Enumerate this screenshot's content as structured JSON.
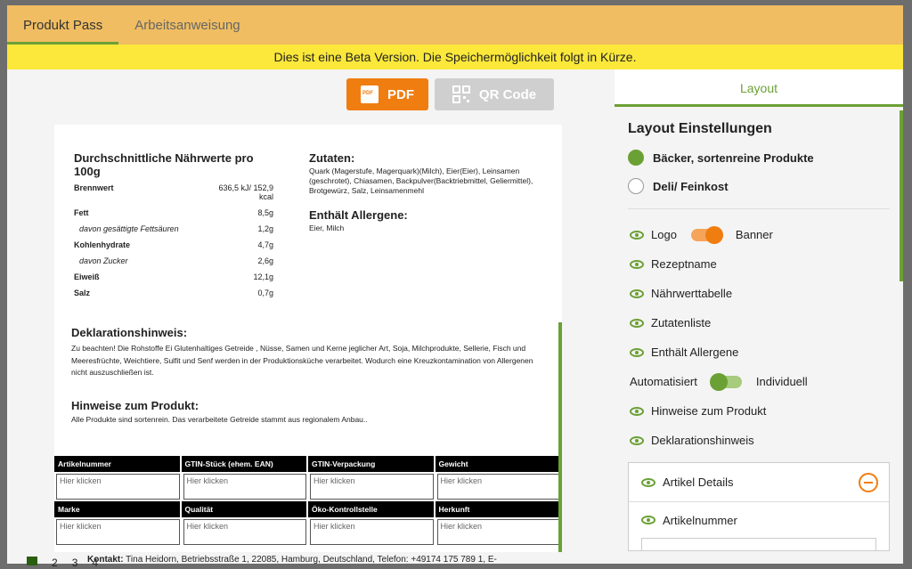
{
  "tabs": [
    {
      "label": "Produkt Pass",
      "active": true
    },
    {
      "label": "Arbeitsanweisung",
      "active": false
    }
  ],
  "beta_banner": "Dies ist eine Beta Version. Die Speichermöglichkeit folgt in Kürze.",
  "toolbar": {
    "pdf_label": "PDF",
    "qr_label": "QR Code"
  },
  "nutrition": {
    "title": "Durchschnittliche Nährwerte pro 100g",
    "rows": [
      {
        "label": "Brennwert",
        "value": "636,5 kJ/ 152,9 kcal",
        "sub": false
      },
      {
        "label": "Fett",
        "value": "8,5g",
        "sub": false
      },
      {
        "label": "davon gesättigte Fettsäuren",
        "value": "1,2g",
        "sub": true
      },
      {
        "label": "Kohlenhydrate",
        "value": "4,7g",
        "sub": false
      },
      {
        "label": "davon Zucker",
        "value": "2,6g",
        "sub": true
      },
      {
        "label": "Eiweiß",
        "value": "12,1g",
        "sub": false
      },
      {
        "label": "Salz",
        "value": "0,7g",
        "sub": false
      }
    ]
  },
  "ingredients": {
    "title": "Zutaten:",
    "text": "Quark (Magerstufe, Magerquark)(Milch), Eier(Eier), Leinsamen (geschrotet), Chiasamen, Backpulver(Backtriebmittel, Geliermittel), Brotgewürz, Salz, Leinsamenmehl",
    "allergens_title": "Enthält Allergene:",
    "allergens_text": "Eier, Milch"
  },
  "declaration": {
    "title": "Deklarationshinweis:",
    "text": "Zu beachten! Die Rohstoffe Ei Glutenhaltiges Getreide , Nüsse, Samen und Kerne jeglicher Art, Soja, Milchprodukte, Sellerie, Fisch und Meeresfrüchte, Weichtiere, Sulfit und Senf werden in der Produktionsküche verarbeitet. Wodurch eine Kreuzkontamination von Allergenen nicht auszuschließen ist."
  },
  "product_hints": {
    "title": "Hinweise zum Produkt:",
    "text": "Alle Produkte sind sortenrein. Das verarbeitete Getreide stammt aus regionalem Anbau.."
  },
  "details_table": {
    "row1_headers": [
      "Artikelnummer",
      "GTIN-Stück (ehem. EAN)",
      "GTIN-Verpackung",
      "Gewicht"
    ],
    "row2_headers": [
      "Marke",
      "Qualität",
      "Öko-Kontrollstelle",
      "Herkunft"
    ],
    "placeholder": "Hier klicken"
  },
  "contact": {
    "label": "Kontakt:",
    "text": "Tina Heidorn, Betriebsstraße 1, 22085, Hamburg, Deutschland, Telefon: +49174 175 789 1, E-"
  },
  "pager": [
    "2",
    "3",
    "4"
  ],
  "sidebar": {
    "tab_label": "Layout",
    "settings_title": "Layout Einstellungen",
    "radio_options": [
      {
        "label": "Bäcker, sortenreine Produkte",
        "selected": true
      },
      {
        "label": "Deli/ Feinkost",
        "selected": false
      }
    ],
    "logo_label": "Logo",
    "banner_label": "Banner",
    "items_top": [
      "Rezeptname",
      "Nährwerttabelle",
      "Zutatenliste",
      "Enthält Allergene"
    ],
    "auto_label": "Automatisiert",
    "individual_label": "Individuell",
    "items_bottom": [
      "Hinweise zum Produkt",
      "Deklarationshinweis"
    ],
    "accordion_title": "Artikel Details",
    "accordion_item": "Artikelnummer"
  },
  "colors": {
    "accent_green": "#6ba034",
    "accent_orange": "#f07d10",
    "tabbar": "#f0bd62",
    "beta_yellow": "#fbe83a"
  }
}
